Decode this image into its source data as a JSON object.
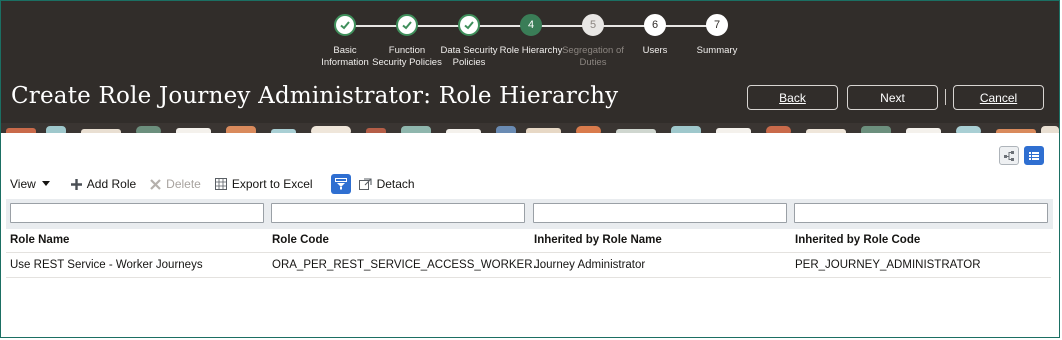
{
  "train": {
    "steps": [
      {
        "num": "",
        "label": "Basic Information",
        "state": "done"
      },
      {
        "num": "",
        "label": "Function Security Policies",
        "state": "done"
      },
      {
        "num": "",
        "label": "Data Security Policies",
        "state": "done"
      },
      {
        "num": "4",
        "label": "Role Hierarchy",
        "state": "current"
      },
      {
        "num": "5",
        "label": "Segregation of Duties",
        "state": "disabled"
      },
      {
        "num": "6",
        "label": "Users",
        "state": "todo"
      },
      {
        "num": "7",
        "label": "Summary",
        "state": "todo"
      }
    ],
    "labels": {
      "s1a": "Basic",
      "s1b": "Information",
      "s2a": "Function",
      "s2b": "Security Policies",
      "s3a": "Data Security",
      "s3b": "Policies",
      "s4a": "Role Hierarchy",
      "s5a": "Segregation of",
      "s5b": "Duties",
      "s6a": "Users",
      "s7a": "Summary"
    }
  },
  "header": {
    "title": "Create Role Journey Administrator: Role Hierarchy",
    "back_label": "Back",
    "next_label": "Next",
    "cancel_label": "Cancel"
  },
  "toolbar": {
    "view_label": "View",
    "add_role_label": "Add Role",
    "delete_label": "Delete",
    "export_label": "Export to Excel",
    "detach_label": "Detach"
  },
  "table": {
    "columns": [
      "Role Name",
      "Role Code",
      "Inherited by Role Name",
      "Inherited by Role Code"
    ],
    "rows": [
      [
        "Use REST Service - Worker Journeys",
        "ORA_PER_REST_SERVICE_ACCESS_WORKER…",
        "Journey Administrator",
        "PER_JOURNEY_ADMINISTRATOR"
      ]
    ]
  },
  "colors": {
    "header_bg": "#312d2a",
    "accent_green": "#3a7d57",
    "toggle_active": "#2f6fd1"
  }
}
